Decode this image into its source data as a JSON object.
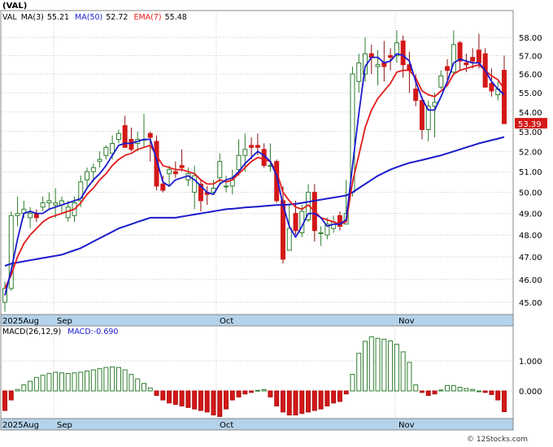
{
  "chart_data": [
    {
      "type": "candlestick",
      "symbol": "(VAL)",
      "legend": {
        "symbol": "VAL",
        "ma3_label": "MA(3)",
        "ma3_value": "55.21",
        "ma50_label": "MA(50)",
        "ma50_value": "52.72",
        "ema7_label": "EMA(7)",
        "ema7_value": "55.48"
      },
      "last_price_label": "53.39",
      "y_ticks": [
        "45.00",
        "46.00",
        "47.00",
        "48.00",
        "49.00",
        "50.00",
        "51.00",
        "52.00",
        "53.00",
        "54.00",
        "55.00",
        "56.00",
        "57.00",
        "58.00"
      ],
      "x_labels": [
        "2025Aug",
        "Sep",
        "Oct",
        "Nov"
      ],
      "ohlc": [
        [
          45.0,
          45.9,
          44.6,
          45.6
        ],
        [
          45.6,
          49.1,
          45.5,
          48.9
        ],
        [
          48.9,
          49.8,
          48.4,
          49.0
        ],
        [
          49.0,
          49.6,
          48.8,
          49.2
        ],
        [
          48.8,
          49.3,
          48.3,
          49.0
        ],
        [
          49.0,
          49.2,
          48.6,
          48.8
        ],
        [
          49.3,
          49.8,
          49.1,
          49.5
        ],
        [
          49.5,
          50.0,
          49.2,
          49.6
        ],
        [
          49.4,
          50.2,
          48.8,
          49.5
        ],
        [
          49.4,
          49.8,
          49.0,
          49.6
        ],
        [
          48.8,
          49.6,
          48.6,
          49.3
        ],
        [
          48.9,
          49.8,
          48.6,
          49.5
        ],
        [
          49.6,
          50.8,
          49.3,
          50.5
        ],
        [
          50.6,
          51.2,
          50.2,
          51.0
        ],
        [
          51.0,
          51.4,
          50.5,
          51.2
        ],
        [
          51.5,
          52.0,
          51.2,
          51.6
        ],
        [
          51.8,
          52.3,
          51.6,
          52.2
        ],
        [
          51.9,
          52.8,
          51.6,
          52.4
        ],
        [
          52.6,
          53.1,
          52.4,
          52.9
        ],
        [
          53.3,
          53.8,
          52.4,
          52.2
        ],
        [
          52.6,
          53.2,
          52.0,
          52.1
        ],
        [
          52.4,
          53.0,
          52.0,
          52.6
        ],
        [
          52.6,
          53.9,
          52.2,
          52.6
        ],
        [
          52.9,
          53.0,
          51.5,
          52.7
        ],
        [
          52.5,
          52.8,
          50.1,
          50.3
        ],
        [
          50.4,
          50.8,
          50.0,
          50.1
        ],
        [
          50.9,
          51.3,
          50.3,
          51.1
        ],
        [
          51.0,
          51.5,
          50.7,
          50.9
        ],
        [
          51.3,
          52.1,
          51.0,
          51.2
        ],
        [
          50.6,
          51.2,
          50.3,
          50.9
        ],
        [
          50.0,
          51.3,
          49.2,
          50.8
        ],
        [
          50.4,
          50.6,
          49.1,
          49.6
        ],
        [
          50.0,
          50.3,
          49.4,
          49.9
        ],
        [
          50.0,
          50.6,
          49.9,
          50.2
        ],
        [
          50.7,
          51.9,
          50.4,
          51.5
        ],
        [
          50.3,
          50.8,
          50.0,
          50.3
        ],
        [
          50.3,
          51.1,
          49.9,
          50.6
        ],
        [
          51.1,
          52.6,
          50.8,
          51.8
        ],
        [
          51.8,
          52.9,
          51.0,
          52.1
        ],
        [
          52.3,
          52.7,
          51.6,
          52.2
        ],
        [
          52.3,
          52.9,
          51.8,
          52.2
        ],
        [
          52.1,
          52.4,
          51.2,
          51.3
        ],
        [
          51.3,
          52.4,
          51.0,
          51.3
        ],
        [
          51.5,
          51.6,
          49.5,
          49.6
        ],
        [
          49.6,
          50.3,
          46.7,
          46.9
        ],
        [
          47.3,
          49.4,
          47.3,
          48.3
        ],
        [
          49.0,
          49.6,
          48.0,
          48.2
        ],
        [
          48.1,
          49.4,
          47.9,
          49.1
        ],
        [
          48.7,
          50.4,
          48.6,
          50.0
        ],
        [
          50.0,
          50.4,
          47.7,
          48.2
        ],
        [
          48.1,
          48.4,
          47.5,
          48.1
        ],
        [
          48.0,
          48.8,
          47.8,
          48.5
        ],
        [
          48.3,
          48.9,
          48.1,
          48.6
        ],
        [
          48.9,
          49.1,
          48.2,
          48.4
        ],
        [
          48.5,
          50.6,
          48.5,
          49.0
        ],
        [
          50.0,
          56.4,
          49.8,
          56.0
        ],
        [
          55.6,
          57.1,
          55.0,
          56.6
        ],
        [
          56.0,
          58.0,
          55.6,
          57.1
        ],
        [
          57.1,
          57.6,
          56.0,
          56.9
        ],
        [
          56.4,
          57.3,
          55.4,
          56.5
        ],
        [
          56.6,
          57.8,
          55.6,
          56.4
        ],
        [
          57.0,
          57.4,
          56.2,
          56.9
        ],
        [
          57.0,
          58.4,
          56.6,
          57.7
        ],
        [
          57.8,
          58.1,
          55.8,
          56.5
        ],
        [
          56.5,
          57.2,
          55.0,
          56.2
        ],
        [
          55.2,
          56.0,
          54.3,
          54.6
        ],
        [
          54.6,
          54.8,
          52.6,
          53.1
        ],
        [
          53.1,
          54.6,
          52.5,
          54.3
        ],
        [
          54.3,
          55.0,
          52.7,
          54.5
        ],
        [
          55.3,
          56.2,
          55.2,
          55.9
        ],
        [
          56.4,
          56.8,
          55.6,
          56.2
        ],
        [
          56.1,
          58.4,
          56.0,
          57.6
        ],
        [
          57.7,
          57.8,
          56.2,
          56.7
        ],
        [
          56.6,
          57.1,
          56.1,
          56.5
        ],
        [
          56.9,
          57.4,
          56.3,
          56.7
        ],
        [
          57.3,
          58.2,
          56.3,
          56.6
        ],
        [
          57.1,
          57.4,
          55.5,
          55.3
        ],
        [
          55.5,
          56.3,
          54.8,
          55.1
        ],
        [
          54.9,
          55.6,
          54.6,
          55.2
        ],
        [
          56.2,
          57.0,
          53.4,
          53.4
        ]
      ],
      "ma3": [
        45.3,
        46.4,
        47.8,
        49.0,
        49.1,
        49.0,
        49.0,
        49.2,
        49.3,
        49.4,
        49.5,
        49.6,
        49.7,
        50.2,
        50.6,
        50.9,
        51.3,
        51.8,
        52.3,
        52.4,
        52.4,
        52.5,
        52.6,
        52.6,
        51.6,
        50.5,
        50.3,
        50.6,
        50.7,
        50.8,
        50.6,
        50.3,
        50.0,
        49.9,
        50.4,
        50.6,
        50.7,
        51.0,
        51.4,
        51.7,
        52.0,
        51.8,
        51.5,
        50.8,
        49.4,
        48.4,
        47.9,
        48.4,
        49.0,
        49.0,
        48.8,
        48.4,
        48.5,
        48.5,
        48.7,
        51.3,
        53.9,
        56.4,
        56.9,
        56.9,
        56.6,
        56.7,
        57.1,
        57.0,
        56.7,
        55.6,
        54.7,
        54.1,
        54.1,
        54.8,
        55.6,
        56.6,
        56.8,
        56.7,
        56.6,
        56.6,
        56.2,
        55.6,
        55.2,
        54.9
      ],
      "ema7": [
        45.6,
        46.2,
        47.0,
        47.6,
        48.0,
        48.3,
        48.6,
        48.8,
        48.9,
        49.0,
        49.1,
        49.2,
        49.5,
        49.9,
        50.2,
        50.6,
        50.9,
        51.3,
        51.6,
        51.8,
        51.9,
        52.1,
        52.2,
        52.3,
        51.8,
        51.3,
        51.2,
        51.1,
        51.1,
        51.0,
        50.9,
        50.6,
        50.4,
        50.4,
        50.6,
        50.5,
        50.6,
        50.9,
        51.2,
        51.5,
        51.7,
        51.6,
        51.5,
        51.0,
        50.0,
        49.6,
        49.3,
        49.2,
        49.4,
        49.1,
        48.8,
        48.7,
        48.6,
        48.5,
        48.6,
        50.5,
        51.8,
        53.2,
        54.1,
        54.7,
        55.1,
        55.5,
        56.1,
        56.2,
        56.2,
        55.8,
        55.1,
        54.9,
        54.8,
        55.1,
        55.4,
        56.0,
        56.2,
        56.3,
        56.4,
        56.5,
        56.2,
        55.9,
        55.7,
        55.2
      ],
      "ma50": [
        46.6,
        46.7,
        46.75,
        46.8,
        46.85,
        46.9,
        46.95,
        47.0,
        47.05,
        47.1,
        47.2,
        47.3,
        47.4,
        47.55,
        47.7,
        47.85,
        48.0,
        48.15,
        48.3,
        48.4,
        48.5,
        48.6,
        48.7,
        48.8,
        48.8,
        48.8,
        48.8,
        48.8,
        48.85,
        48.9,
        48.95,
        49.0,
        49.05,
        49.1,
        49.15,
        49.2,
        49.22,
        49.25,
        49.28,
        49.3,
        49.32,
        49.35,
        49.37,
        49.4,
        49.4,
        49.42,
        49.45,
        49.5,
        49.55,
        49.6,
        49.65,
        49.7,
        49.75,
        49.8,
        49.85,
        50.0,
        50.2,
        50.4,
        50.6,
        50.8,
        50.95,
        51.1,
        51.22,
        51.33,
        51.43,
        51.5,
        51.57,
        51.65,
        51.73,
        51.8,
        51.9,
        52.0,
        52.1,
        52.2,
        52.3,
        52.4,
        52.48,
        52.56,
        52.64,
        52.72
      ],
      "macd_panel": {
        "label": "MACD(26,12,9)",
        "value_label": "MACD:-0.690",
        "y_ticks": [
          "0.000",
          "1.000"
        ],
        "x_labels": [
          "2025Aug",
          "Sep",
          "Oct",
          "Nov"
        ],
        "histogram": [
          -0.65,
          -0.3,
          0.05,
          0.2,
          0.32,
          0.45,
          0.52,
          0.58,
          0.62,
          0.6,
          0.58,
          0.6,
          0.62,
          0.66,
          0.7,
          0.74,
          0.78,
          0.8,
          0.78,
          0.7,
          0.55,
          0.4,
          0.25,
          0.1,
          -0.15,
          -0.3,
          -0.4,
          -0.45,
          -0.5,
          -0.55,
          -0.6,
          -0.65,
          -0.7,
          -0.8,
          -0.85,
          -0.6,
          -0.3,
          -0.2,
          -0.1,
          -0.05,
          0.02,
          0.04,
          -0.2,
          -0.5,
          -0.7,
          -0.8,
          -0.8,
          -0.75,
          -0.7,
          -0.65,
          -0.6,
          -0.5,
          -0.4,
          -0.35,
          -0.1,
          0.55,
          1.25,
          1.65,
          1.8,
          1.75,
          1.72,
          1.66,
          1.55,
          1.3,
          0.95,
          0.2,
          -0.05,
          -0.15,
          -0.1,
          0.03,
          0.18,
          0.18,
          0.12,
          0.08,
          0.05,
          0.0,
          -0.05,
          -0.12,
          -0.3,
          -0.69
        ]
      }
    }
  ]
}
